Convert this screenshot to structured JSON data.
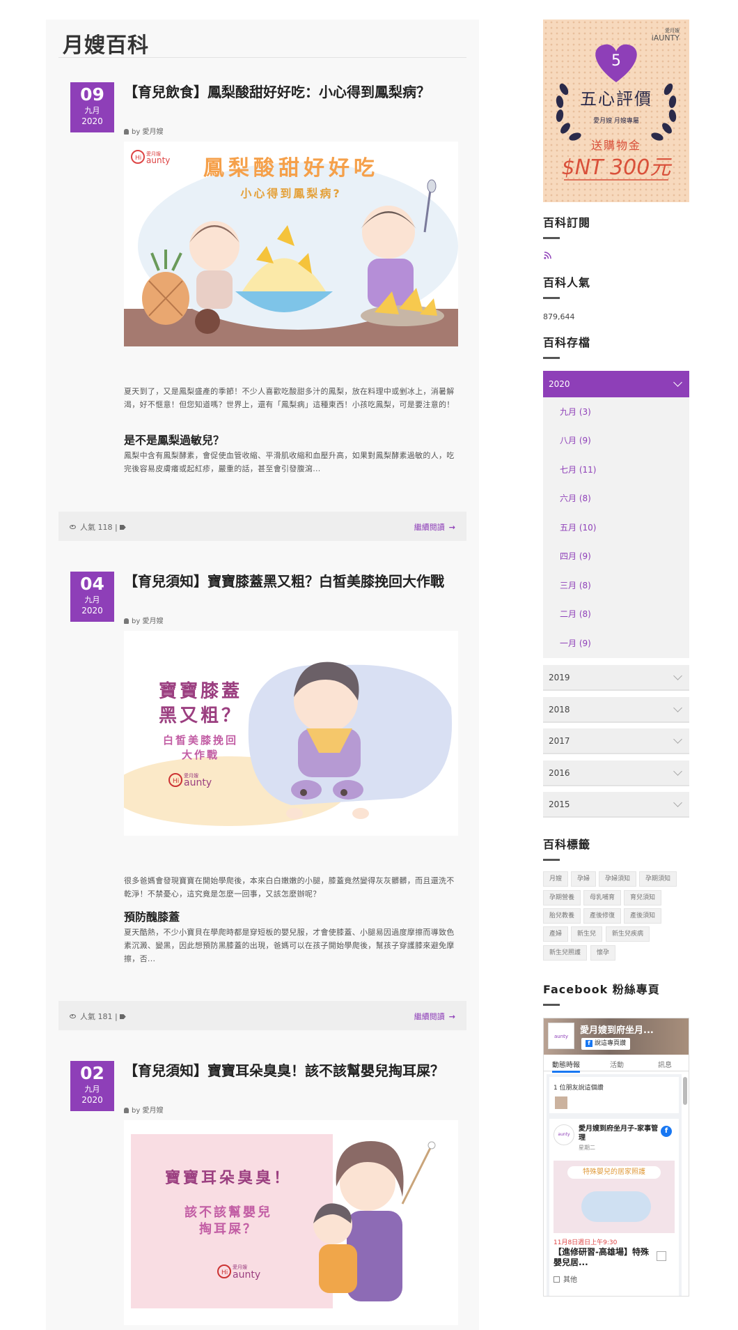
{
  "main": {
    "title": "月嫂百科",
    "posts": [
      {
        "day": "09",
        "month": "九月",
        "year": "2020",
        "title": "【育兒飲食】鳳梨酸甜好好吃：小心得到鳳梨病？",
        "author": "by 愛月嫂",
        "image": {
          "logo": "愛月嫂",
          "logo_en": "aunty",
          "headline": "鳳梨酸甜好好吃",
          "subheadline": "小心得到鳳梨病?"
        },
        "excerpt": "夏天到了，又是鳳梨盛產的季節！不少人喜歡吃酸甜多汁的鳳梨，放在料理中或剉冰上，消暑解渴，好不愜意！但您知道嗎？世界上，還有「鳳梨病」這種東西！小孩吃鳳梨，可是要注意的！",
        "subheading": "是不是鳳梨過敏兒？",
        "subtext": "鳳梨中含有鳳梨酵素，會促使血管收縮、平滑肌收縮和血壓升高，如果對鳳梨酵素過敏的人，吃完後容易皮膚癢或起紅疹，嚴重的話，甚至會引發腹瀉...",
        "views": "人氣 118",
        "readmore": "繼續閱讀"
      },
      {
        "day": "04",
        "month": "九月",
        "year": "2020",
        "title": "【育兒須知】寶寶膝蓋黑又粗？白皙美膝挽回大作戰",
        "author": "by 愛月嫂",
        "image": {
          "line1": "寶寶膝蓋",
          "line2": "黑又粗？",
          "line3": "白皙美膝挽回",
          "line4": "大作戰",
          "logo": "愛月嫂",
          "logo_en": "aunty"
        },
        "excerpt": "很多爸媽會發現寶寶在開始學爬後，本來白白嫩嫩的小腿，膝蓋竟然變得灰灰髒髒，而且還洗不乾淨！不禁憂心，這究竟是怎麼一回事，又該怎麼辦呢？",
        "subheading": "預防醜膝蓋",
        "subtext": "夏天酷熱，不少小寶貝在學爬時都是穿短板的嬰兒服，才會使膝蓋、小腿易因過度摩擦而導致色素沉澱、變黑，因此想預防黑膝蓋的出現，爸媽可以在孩子開始學爬後，幫孩子穿護膝來避免摩擦，否...",
        "views": "人氣 181",
        "readmore": "繼續閱讀"
      },
      {
        "day": "02",
        "month": "九月",
        "year": "2020",
        "title": "【育兒須知】寶寶耳朵臭臭！該不該幫嬰兒掏耳屎？",
        "author": "by 愛月嫂",
        "image": {
          "line1": "寶寶耳朵臭臭！",
          "line2": "該不該幫嬰兒",
          "line3": "掏耳屎？",
          "logo": "愛月嫂",
          "logo_en": "aunty"
        }
      }
    ]
  },
  "sidebar": {
    "ad": {
      "brand_small": "愛月嫂",
      "brand": "iAUNTY",
      "heart_number": "5",
      "title": "五心評價",
      "subtitle": "愛月嫂 月嫂專屬",
      "offer": "送購物金",
      "amount": "$NT 300元"
    },
    "subscribe_title": "百科訂閱",
    "popularity_title": "百科人氣",
    "popularity_count": "879,644",
    "archive_title": "百科存檔",
    "archive_open_year": "2020",
    "archive_months": [
      "九月 (3)",
      "八月 (9)",
      "七月 (11)",
      "六月 (8)",
      "五月 (10)",
      "四月 (9)",
      "三月 (8)",
      "二月 (8)",
      "一月 (9)"
    ],
    "archive_years": [
      "2019",
      "2018",
      "2017",
      "2016",
      "2015"
    ],
    "tags_title": "百科標籤",
    "tags": [
      "月嫂",
      "孕婦",
      "孕婦須知",
      "孕期須知",
      "孕期營養",
      "母乳哺育",
      "育兒須知",
      "胎兒教養",
      "產後修復",
      "產後須知",
      "產婦",
      "新生兒",
      "新生兒疾病",
      "新生兒照護",
      "懷孕"
    ],
    "facebook_title": "Facebook 粉絲專頁",
    "facebook": {
      "page_name": "愛月嫂到府坐月...",
      "share": "說這專頁讚",
      "tabs": [
        "動態時報",
        "活動",
        "訊息"
      ],
      "friends": "1 位朋友說這個讚",
      "post_author": "愛月嫂到府坐月子-家事管理",
      "post_time": "星期二",
      "post_image_text": "特殊嬰兒的居家照護",
      "event_date": "11月8日週日上午9:30",
      "event_title": "【進修研習-高雄場】特殊嬰兒居...",
      "event_more": "其他",
      "logo": "aunty"
    }
  },
  "colors": {
    "accent": "#8e3fb8",
    "footer_bg": "#eeeeee",
    "facebook": "#1877f2"
  }
}
